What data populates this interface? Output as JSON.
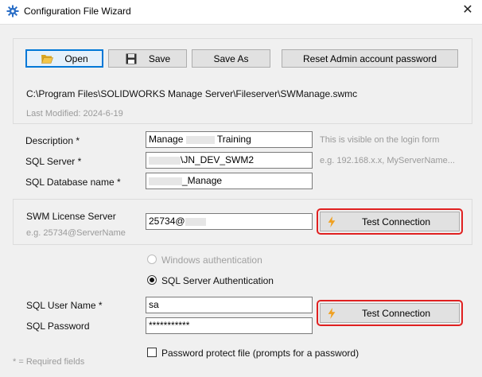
{
  "window": {
    "title": "Configuration File Wizard",
    "close_glyph": "✕"
  },
  "toolbar": {
    "open_label": "Open",
    "save_label": "Save",
    "save_as_label": "Save As",
    "reset_label": "Reset Admin account password"
  },
  "file": {
    "path": "C:\\Program Files\\SOLIDWORKS Manage Server\\Fileserver\\SWManage.swmc",
    "last_modified": "Last Modified: 2024-6-19"
  },
  "form": {
    "description": {
      "label": "Description *",
      "value_prefix": "Manage",
      "value_suffix": "Training",
      "hint": "This is visible on the login form"
    },
    "sql_server": {
      "label": "SQL Server *",
      "value_suffix": "\\JN_DEV_SWM2",
      "hint": "e.g. 192.168.x.x,  MyServerName..."
    },
    "sql_db": {
      "label": "SQL Database name *",
      "value_suffix": "_Manage"
    },
    "license": {
      "label": "SWM License Server",
      "hint": "e.g. 25734@ServerName",
      "value_prefix": "25734@",
      "test_label": "Test Connection"
    },
    "auth": {
      "windows_label": "Windows authentication",
      "sql_label": "SQL Server Authentication"
    },
    "sql_user": {
      "label": "SQL User Name *",
      "value": "sa"
    },
    "sql_password": {
      "label": "SQL Password",
      "value": "***********",
      "test_label": "Test Connection"
    },
    "protect": {
      "label": "Password protect file (prompts for a password)"
    },
    "required_note": "* = Required fields"
  },
  "colors": {
    "highlight": "#e02020",
    "bolt": "#f0a020",
    "accent": "#0078d7"
  }
}
